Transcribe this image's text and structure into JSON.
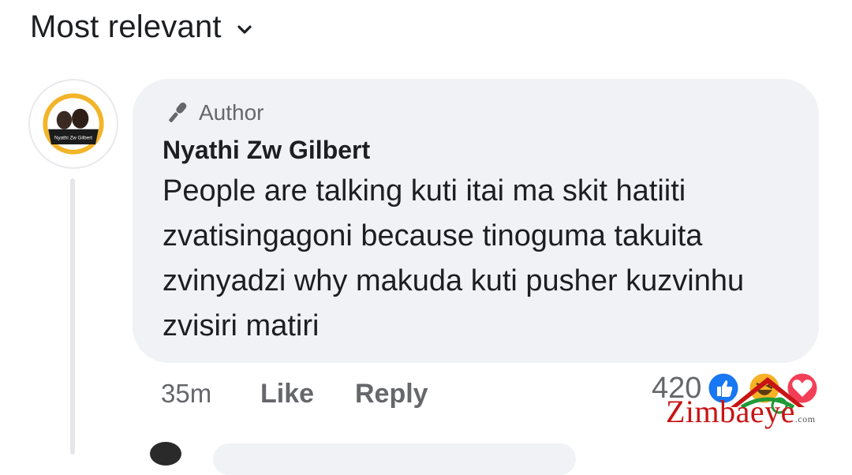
{
  "sort": {
    "label": "Most relevant",
    "icon": "chevron-down-icon"
  },
  "comment": {
    "badge": {
      "icon": "microphone-icon",
      "label": "Author"
    },
    "avatar_text": "Nyathi Zw Gilbert",
    "author": "Nyathi Zw Gilbert",
    "text": "People are talking kuti itai ma skit hatiiti zvatisingagoni because tinoguma takuita zvinyadzi why makuda kuti pusher kuzvinhu zvisiri matiri",
    "time": "35m",
    "like_label": "Like",
    "reply_label": "Reply",
    "reaction_count": "420",
    "reaction_icons": [
      "like-reaction-icon",
      "haha-reaction-icon",
      "love-reaction-icon"
    ]
  },
  "watermark": {
    "text": "Zimbaeye",
    "suffix": ".com"
  },
  "colors": {
    "bubble": "#f0f2f5",
    "secondary_text": "#65676b",
    "like_blue": "#1877f2",
    "love_red": "#f33e58",
    "watermark_red": "#c81414"
  }
}
